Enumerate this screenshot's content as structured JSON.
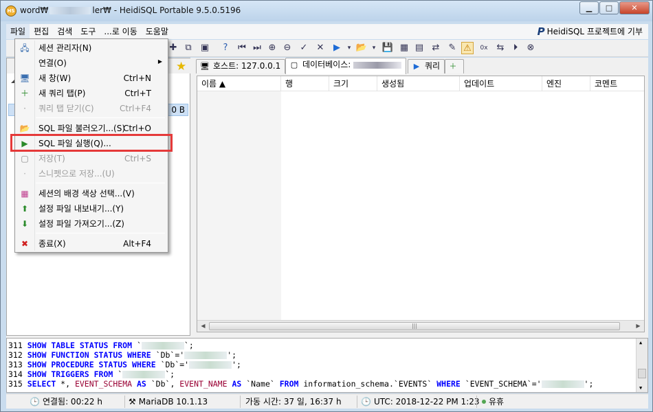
{
  "window": {
    "title_prefix": "word₩",
    "title_mid": "ler₩",
    "title_suffix": " - HeidiSQL Portable 9.5.0.5196",
    "app_icon_text": "HS",
    "minimize": "▁",
    "maximize": "□",
    "close": "✕"
  },
  "menubar": {
    "items": [
      "파일",
      "편집",
      "검색",
      "도구",
      "...로 이동",
      "도움말"
    ],
    "donate_label": "HeidiSQL 프로젝트에 기부",
    "paypal_glyph": "P"
  },
  "left_panel": {
    "tree_size": "0 B"
  },
  "tabs": {
    "host_label": "호스트: 127.0.0.1",
    "database_label": "데이터베이스:",
    "query_label": "쿼리"
  },
  "grid": {
    "columns": [
      "이름 ▲",
      "행",
      "크기",
      "생성됨",
      "업데이트",
      "엔진",
      "코멘트"
    ]
  },
  "sql_log": {
    "lines": [
      {
        "num": "311",
        "parts": [
          [
            "kw",
            "SHOW TABLE STATUS FROM"
          ],
          [
            "plain",
            " `"
          ],
          [
            "blur",
            ""
          ],
          [
            "plain",
            "`;"
          ]
        ]
      },
      {
        "num": "312",
        "parts": [
          [
            "kw",
            "SHOW FUNCTION STATUS WHERE"
          ],
          [
            "plain",
            " `Db`='"
          ],
          [
            "blur",
            ""
          ],
          [
            "plain",
            "';"
          ]
        ]
      },
      {
        "num": "313",
        "parts": [
          [
            "kw",
            "SHOW PROCEDURE STATUS WHERE"
          ],
          [
            "plain",
            " `Db`='"
          ],
          [
            "blur",
            ""
          ],
          [
            "plain",
            "';"
          ]
        ]
      },
      {
        "num": "314",
        "parts": [
          [
            "kw",
            "SHOW TRIGGERS FROM"
          ],
          [
            "plain",
            " `"
          ],
          [
            "blur",
            ""
          ],
          [
            "plain",
            "`;"
          ]
        ]
      },
      {
        "num": "315",
        "parts": [
          [
            "kw",
            "SELECT"
          ],
          [
            "plain",
            " *, "
          ],
          [
            "tbl",
            "EVENT_SCHEMA"
          ],
          [
            "kw",
            " AS"
          ],
          [
            "plain",
            " `Db`, "
          ],
          [
            "tbl",
            "EVENT_NAME"
          ],
          [
            "kw",
            " AS"
          ],
          [
            "plain",
            " `Name` "
          ],
          [
            "kw",
            "FROM"
          ],
          [
            "plain",
            " information_schema.`EVENTS` "
          ],
          [
            "kw",
            "WHERE"
          ],
          [
            "plain",
            " `EVENT_SCHEMA`='"
          ],
          [
            "blur",
            ""
          ],
          [
            "plain",
            "';"
          ]
        ]
      }
    ]
  },
  "statusbar": {
    "connected": "연결됨: 00:22 h",
    "server": "MariaDB 10.1.13",
    "uptime": "가동 시간: 37 일, 16:37 h",
    "utc": "UTC: 2018-12-22 PM 1:23",
    "state": "유휴"
  },
  "file_menu": {
    "items": [
      {
        "label": "세션 관리자(N)",
        "shortcut": "",
        "icon": "session-manager-icon",
        "glyph": "🖧",
        "disabled": false
      },
      {
        "label": "연결(O)",
        "shortcut": "",
        "icon": "",
        "glyph": "",
        "disabled": false,
        "submenu": true
      },
      {
        "label": "새 창(W)",
        "shortcut": "Ctrl+N",
        "icon": "new-window-icon",
        "glyph": "🖥",
        "disabled": false
      },
      {
        "label": "새 쿼리 탭(P)",
        "shortcut": "Ctrl+T",
        "icon": "new-query-tab-icon",
        "glyph": "＋",
        "disabled": false
      },
      {
        "label": "쿼리 탭 닫기(C)",
        "shortcut": "Ctrl+F4",
        "icon": "close-query-tab-icon",
        "glyph": "·",
        "disabled": true
      },
      {
        "label": "SQL 파일 불러오기...(S)",
        "shortcut": "Ctrl+O",
        "icon": "open-sql-file-icon",
        "glyph": "📂",
        "disabled": false
      },
      {
        "label": "SQL 파일 실행(Q)...",
        "shortcut": "",
        "icon": "run-sql-file-icon",
        "glyph": "▶",
        "disabled": false
      },
      {
        "label": "저장(T)",
        "shortcut": "Ctrl+S",
        "icon": "save-icon",
        "glyph": "▢",
        "disabled": true
      },
      {
        "label": "스니펫으로 저장...(U)",
        "shortcut": "",
        "icon": "save-snippet-icon",
        "glyph": "·",
        "disabled": true
      },
      {
        "label": "세션의 배경 색상 선택...(V)",
        "shortcut": "",
        "icon": "color-palette-icon",
        "glyph": "▦",
        "disabled": false
      },
      {
        "label": "설정 파일 내보내기...(Y)",
        "shortcut": "",
        "icon": "export-settings-icon",
        "glyph": "⬆",
        "disabled": false
      },
      {
        "label": "설정 파일 가져오기...(Z)",
        "shortcut": "",
        "icon": "import-settings-icon",
        "glyph": "⬇",
        "disabled": false
      },
      {
        "label": "종료(X)",
        "shortcut": "Alt+F4",
        "icon": "exit-icon",
        "glyph": "✖",
        "disabled": false
      }
    ]
  },
  "toolbar_icons": [
    "▶",
    "⏮",
    "⏭",
    "⊕",
    "⊖",
    "✓",
    "✕",
    "▶",
    "▾",
    "📂",
    "▾",
    "💾",
    "▦",
    "▤",
    "⇄",
    "✎",
    "⚠",
    "0x",
    "⇆",
    "⏵",
    "⊗"
  ],
  "colors": {
    "highlight": "#e53939",
    "keyword": "#0000ff",
    "selection": "#cde0f5"
  }
}
